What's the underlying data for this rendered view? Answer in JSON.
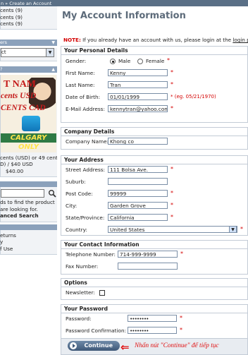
{
  "breadcrumb": "n » Create an Account",
  "left": {
    "cart_lines": [
      "cents (9)",
      "cents (9)",
      "cents (9)"
    ],
    "manufacturers_header": "ers",
    "manufacturers_select": "ct",
    "specials_header": "?",
    "banner": {
      "line1": "T NAM",
      "line2": "cents USD",
      "line3": "CENTS CAD",
      "strip": "CALGARY ONLY"
    },
    "special_lines": [
      "cents (USD) or 49 cents",
      "D) / $40 USD",
      "$40.00"
    ],
    "search_lines": [
      "ds to find the product",
      "are looking for.",
      "anced Search"
    ],
    "info_lines": [
      "eturns",
      "y",
      "f Use"
    ]
  },
  "main": {
    "title": "My Account Information",
    "note_label": "NOTE:",
    "note_text": " If you already have an account with us, please login at the ",
    "note_link": "login pag",
    "personal": {
      "header": "Your Personal Details",
      "gender_label": "Gender:",
      "male": "Male",
      "female": "Female",
      "first_name_label": "First Name:",
      "first_name": "Kenny",
      "last_name_label": "Last Name:",
      "last_name": "Tran",
      "dob_label": "Date of Birth:",
      "dob": "01/01/1999",
      "dob_hint": "(eg. 05/21/1970)",
      "email_label": "E-Mail Address:",
      "email": "kennytran@yahoo.com"
    },
    "company": {
      "header": "Company Details",
      "name_label": "Company Name:",
      "name": "Khong co"
    },
    "address": {
      "header": "Your Address",
      "street_label": "Street Address:",
      "street": "111 Bolsa Ave.",
      "suburb_label": "Suburb:",
      "suburb": "",
      "postcode_label": "Post Code:",
      "postcode": "99999",
      "city_label": "City:",
      "city": "Garden Grove",
      "state_label": "State/Province:",
      "state": "California",
      "country_label": "Country:",
      "country": "United States"
    },
    "contact": {
      "header": "Your Contact Information",
      "phone_label": "Telephone Number:",
      "phone": "714-999-9999",
      "fax_label": "Fax Number:",
      "fax": ""
    },
    "options": {
      "header": "Options",
      "newsletter_label": "Newsletter:"
    },
    "password": {
      "header": "Your Password",
      "password_label": "Password:",
      "password": "••••••••",
      "confirm_label": "Password Confirmation:",
      "confirm": "••••••••"
    },
    "required_mark": "*",
    "continue_label": "Continue",
    "instruction": "Nhấn nút \"Continue\" để tiếp tục"
  },
  "colors": {
    "accent": "#5a6f86",
    "required": "#d40000"
  }
}
